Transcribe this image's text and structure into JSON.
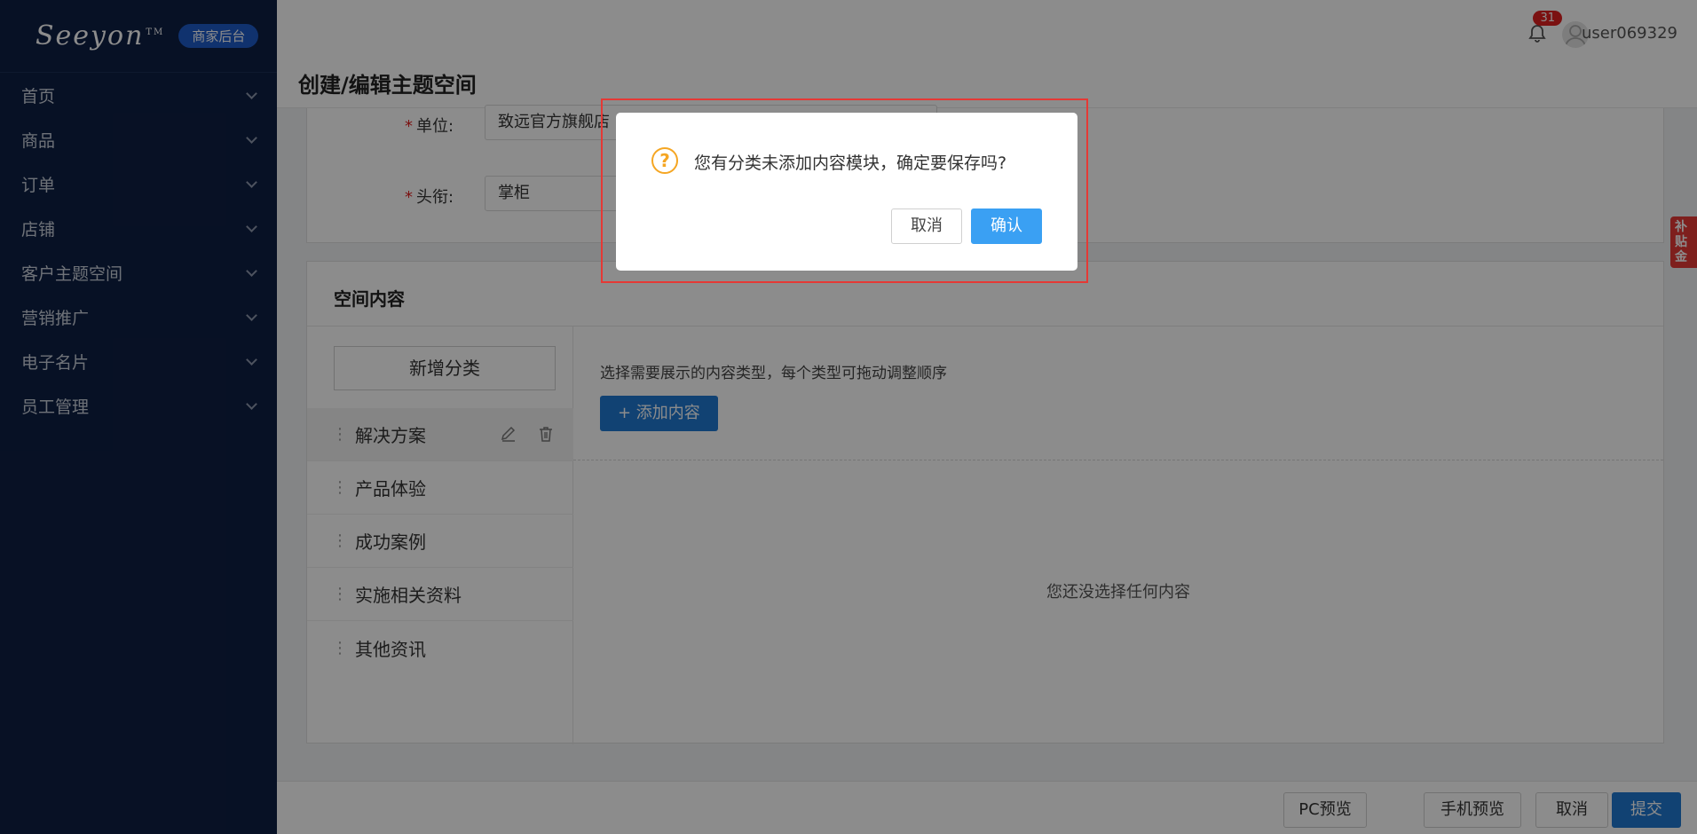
{
  "sidebar": {
    "logo": "Seeyon",
    "logo_tm": "TM",
    "badge": "商家后台",
    "items": [
      {
        "label": "首页"
      },
      {
        "label": "商品"
      },
      {
        "label": "订单"
      },
      {
        "label": "店铺"
      },
      {
        "label": "客户主题空间"
      },
      {
        "label": "营销推广"
      },
      {
        "label": "电子名片"
      },
      {
        "label": "员工管理"
      }
    ]
  },
  "header": {
    "title": "创建/编辑主题空间",
    "notification_count": "31",
    "username": "user069329"
  },
  "form": {
    "unit_label": "单位:",
    "unit_value": "致远官方旗舰店",
    "title_label": "头衔:",
    "title_value": "掌柜"
  },
  "space": {
    "title": "空间内容",
    "add_category": "新增分类",
    "categories": [
      {
        "label": "解决方案"
      },
      {
        "label": "产品体验"
      },
      {
        "label": "成功案例"
      },
      {
        "label": "实施相关资料"
      },
      {
        "label": "其他资讯"
      }
    ],
    "hint": "选择需要展示的内容类型，每个类型可拖动调整顺序",
    "add_content": "+ 添加内容",
    "empty": "您还没选择任何内容"
  },
  "footer": {
    "pc_preview": "PC预览",
    "mobile_preview": "手机预览",
    "cancel": "取消",
    "submit": "提交"
  },
  "ribbon": "补贴金",
  "dialog": {
    "message": "您有分类未添加内容模块，确定要保存吗?",
    "cancel": "取消",
    "confirm": "确认"
  },
  "colors": {
    "sidebar_bg": "#0e1f44",
    "primary": "#1f78d1",
    "dialog_primary": "#3aa0f3",
    "warning": "#f5a623",
    "highlight": "#e53935"
  }
}
